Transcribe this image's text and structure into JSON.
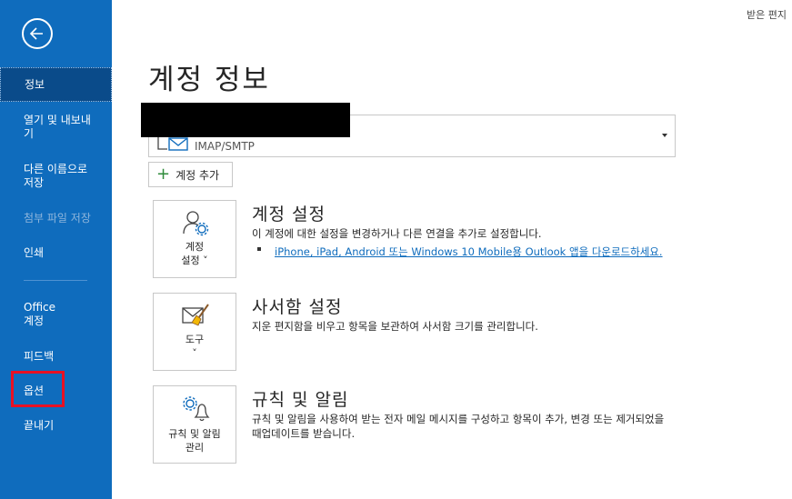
{
  "top_right": {
    "text": "받은 편지"
  },
  "sidebar": {
    "items": [
      {
        "label": "정보"
      },
      {
        "label": "열기 및 내보내기"
      },
      {
        "label": "다른 이름으로 저장"
      },
      {
        "label": "첨부 파일 저장"
      },
      {
        "label": "인쇄"
      },
      {
        "label": "Office 계정"
      },
      {
        "label": "피드백"
      },
      {
        "label": "옵션"
      },
      {
        "label": "끝내기"
      }
    ]
  },
  "main": {
    "title": "계정 정보",
    "account": {
      "type": "IMAP/SMTP"
    },
    "add_account_label": "계정 추가",
    "sections": [
      {
        "tile_label": "계정\n설정 ˅",
        "title": "계정 설정",
        "desc": "이 계정에 대한 설정을 변경하거나 다른 연결을 추가로 설정합니다.",
        "link": "iPhone, iPad, Android 또는 Windows 10 Mobile용 Outlook 앱을 다운로드하세요."
      },
      {
        "tile_label": "도구\n˅",
        "title": "사서함 설정",
        "desc": "지운 편지함을 비우고 항목을 보관하여 사서함 크기를 관리합니다."
      },
      {
        "tile_label": "규칙 및 알림\n관리",
        "title": "규칙 및 알림",
        "desc": "규칙 및 알림을 사용하여 받는 전자 메일 메시지를 구성하고 항목이 추가, 변경 또는 제거되었을 때업데이트를 받습니다."
      }
    ]
  },
  "colors": {
    "sidebar": "#0f6cbd",
    "sidebar_active": "#0a4b8a",
    "highlight": "#e81123",
    "link": "#0f6cbd"
  }
}
